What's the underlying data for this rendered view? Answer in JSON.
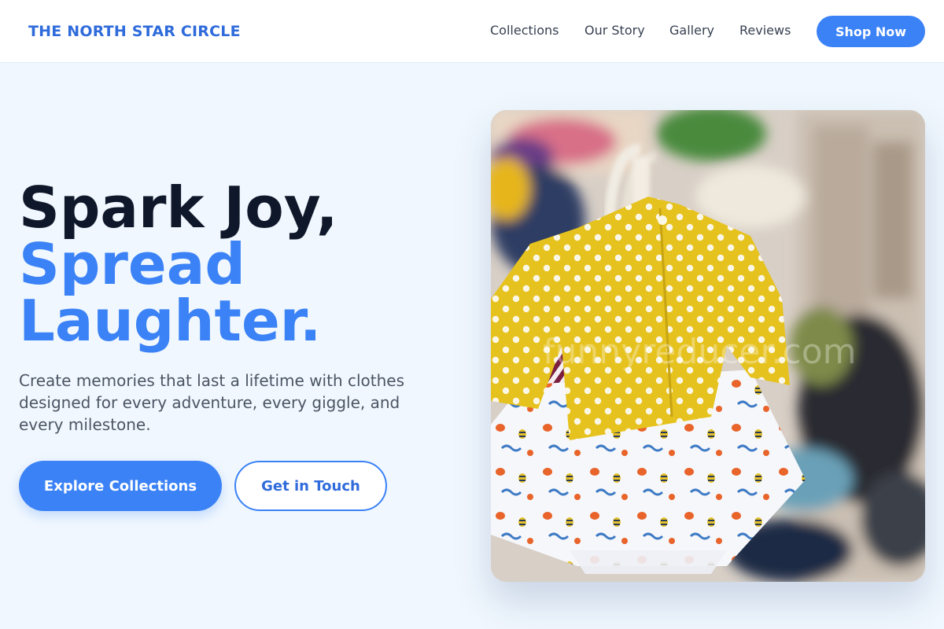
{
  "header": {
    "brand": "THE NORTH STAR CIRCLE",
    "nav": [
      "Collections",
      "Our Story",
      "Gallery",
      "Reviews"
    ],
    "cta": "Shop Now"
  },
  "hero": {
    "headline_line1": "Spark Joy,",
    "headline_line2": "Spread",
    "headline_line3": "Laughter.",
    "subtitle": "Create memories that last a lifetime with clothes designed for every adventure, every giggle, and every milestone.",
    "primary_button": "Explore Collections",
    "secondary_button": "Get in Touch",
    "image": {
      "subject": "baby-clothes-on-hangers-photo",
      "watermark": "funnyreducer.com"
    }
  },
  "colors": {
    "accent": "#3b82f6",
    "brand": "#2f6bdb",
    "headline_dark": "#0f172a",
    "page_bg": "#f0f7fe"
  }
}
